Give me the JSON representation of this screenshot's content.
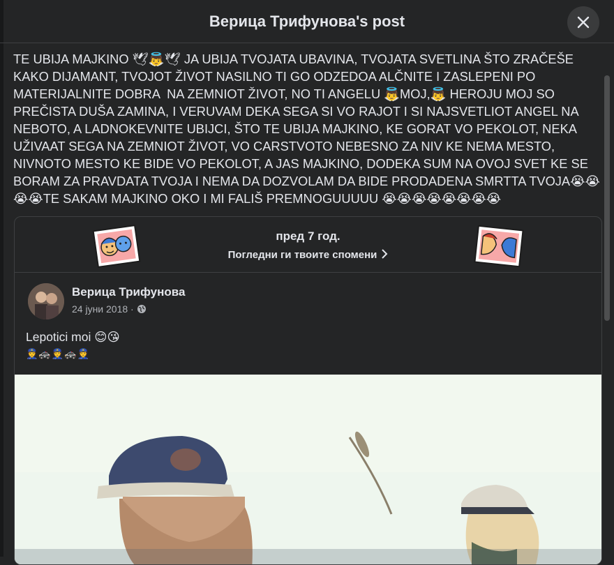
{
  "header": {
    "title": "Верица Трифунова's post"
  },
  "post": {
    "text": "TE UBIJA MAJKINO 🕊👼🕊 JA UBIJA TVOJATA UBAVINA, TVOJATA SVETLINA ŠTO ZRAČEŠE KAKO DIJAMANT, TVOJOT ŽIVOT NASILNO TI GO ODZEDOA ALČNITE I ZASLEPENI PO MATERIJALNITE DOBRA  NA ZEMNIOT ŽIVOT, NO TI ANGELU 👼MOJ,👼 HEROJU MOJ SO PREČISTA DUŠA ZAMINA, I VERUVAM DEKA SEGA SI VO RAJOT I SI NAJSVETLIOT ANGEL NA NEBOTO, A LADNOKEVNITE UBIJCI, ŠTO TE UBIJA MAJKINO, KE GORAT VO PEKOLOT, NEKA UŽIVAAT SEGA NA ZEMNIOT ŽIVOT, VO CARSTVOTO NEBESNO ZA NIV KE NEMA MESTO, NIVNOTO MESTO KE BIDE VO PEKOLOT, A JAS MAJKINO, DODEKA SUM NA OVOJ SVET KE SE BORAM ZA PRAVDATA TVOJA I NEMA DA DOZVOLAM DA BIDE PRODADENA SMRTTA TVOJA😭😭😭😭TE SAKAM MAJKINO OKO I MI FALIŠ PREMNOGUUUUU 😭😭😭😭😭😭😭😭"
  },
  "memory": {
    "ago": "пред 7 год.",
    "link": "Погледни ги твоите спомени"
  },
  "shared_post": {
    "author": "Верица Трифунова",
    "date": "24 јуни 2018 ·",
    "caption": "Lepotici moi 😊😘",
    "caption_emoji": "👮🚓👮🚓👮"
  },
  "colors": {
    "background": "#242526",
    "text": "#e4e6eb",
    "secondary_text": "#b0b3b8",
    "divider": "#3e4042"
  },
  "icons": [
    "close-icon",
    "chevron-right-icon",
    "globe-icon",
    "memories-sticker-icon"
  ]
}
